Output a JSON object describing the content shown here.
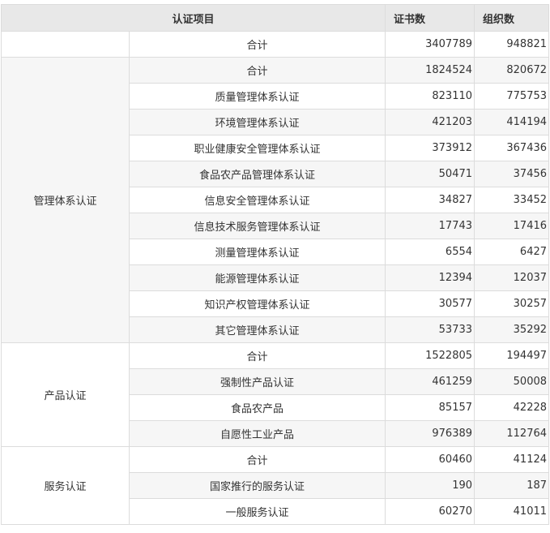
{
  "header": {
    "item": "认证项目",
    "certificates": "证书数",
    "organizations": "组织数"
  },
  "total_row": {
    "label": "合计",
    "certificates": "3407789",
    "organizations": "948821"
  },
  "groups": [
    {
      "category": "管理体系认证",
      "rows": [
        {
          "label": "合计",
          "certificates": "1824524",
          "organizations": "820672"
        },
        {
          "label": "质量管理体系认证",
          "certificates": "823110",
          "organizations": "775753"
        },
        {
          "label": "环境管理体系认证",
          "certificates": "421203",
          "organizations": "414194"
        },
        {
          "label": "职业健康安全管理体系认证",
          "certificates": "373912",
          "organizations": "367436"
        },
        {
          "label": "食品农产品管理体系认证",
          "certificates": "50471",
          "organizations": "37456"
        },
        {
          "label": "信息安全管理体系认证",
          "certificates": "34827",
          "organizations": "33452"
        },
        {
          "label": "信息技术服务管理体系认证",
          "certificates": "17743",
          "organizations": "17416"
        },
        {
          "label": "测量管理体系认证",
          "certificates": "6554",
          "organizations": "6427"
        },
        {
          "label": "能源管理体系认证",
          "certificates": "12394",
          "organizations": "12037"
        },
        {
          "label": "知识产权管理体系认证",
          "certificates": "30577",
          "organizations": "30257"
        },
        {
          "label": "其它管理体系认证",
          "certificates": "53733",
          "organizations": "35292"
        }
      ]
    },
    {
      "category": "产品认证",
      "rows": [
        {
          "label": "合计",
          "certificates": "1522805",
          "organizations": "194497"
        },
        {
          "label": "强制性产品认证",
          "certificates": "461259",
          "organizations": "50008"
        },
        {
          "label": "食品农产品",
          "certificates": "85157",
          "organizations": "42228"
        },
        {
          "label": "自愿性工业产品",
          "certificates": "976389",
          "organizations": "112764"
        }
      ]
    },
    {
      "category": "服务认证",
      "rows": [
        {
          "label": "合计",
          "certificates": "60460",
          "organizations": "41124"
        },
        {
          "label": "国家推行的服务认证",
          "certificates": "190",
          "organizations": "187"
        },
        {
          "label": "一般服务认证",
          "certificates": "60270",
          "organizations": "41011"
        }
      ]
    }
  ]
}
